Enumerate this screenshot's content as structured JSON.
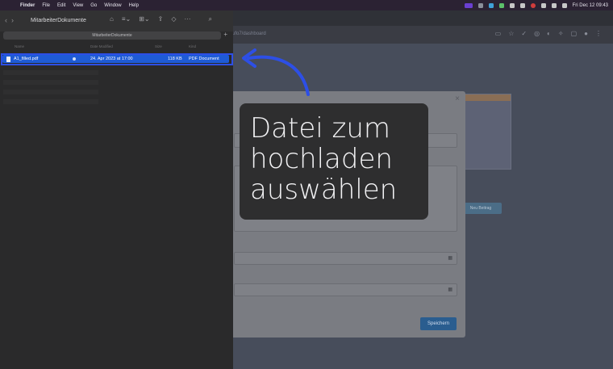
{
  "menubar": {
    "app": "Finder",
    "items": [
      "File",
      "Edit",
      "View",
      "Go",
      "Window",
      "Help"
    ],
    "clock": "Fri Dec 12  09:43"
  },
  "browser": {
    "url": "ufo7/dashboard",
    "modal_save_label": "Speichern",
    "bg_button_label": "Neu Beitrag"
  },
  "finder": {
    "title": "MitarbeiterDokumente",
    "path": "MitarbeiterDokumente",
    "columns": {
      "name": "Name",
      "date": "Date Modified",
      "size": "Size",
      "kind": "Kind"
    },
    "file": {
      "name": "A1_filled.pdf",
      "date": "24. Apr 2023 at 17:00",
      "size": "118 KB",
      "kind": "PDF Document"
    }
  },
  "callout": {
    "line1": "Datei zum",
    "line2": "hochladen",
    "line3": "auswählen"
  },
  "colors": {
    "highlight": "#2d4fe6",
    "selection": "#1e5bd6",
    "callout_bg": "#2e2e2f"
  }
}
